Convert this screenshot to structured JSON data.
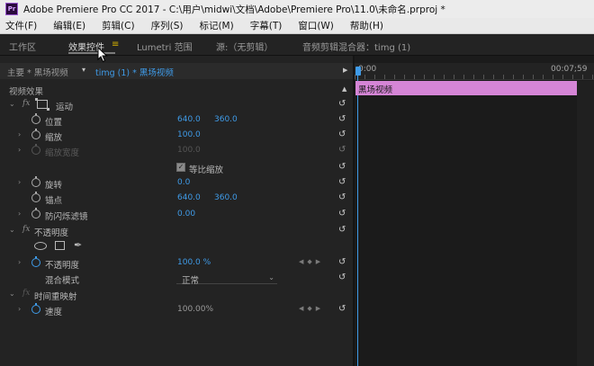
{
  "window": {
    "app_icon": "Pr",
    "title": "Adobe Premiere Pro CC 2017 - C:\\用户\\midwi\\文档\\Adobe\\Premiere Pro\\11.0\\未命名.prproj *"
  },
  "menu": [
    "文件(F)",
    "编辑(E)",
    "剪辑(C)",
    "序列(S)",
    "标记(M)",
    "字幕(T)",
    "窗口(W)",
    "帮助(H)"
  ],
  "tabs": [
    {
      "label": "工作区",
      "active": false
    },
    {
      "label": "效果控件",
      "active": true
    },
    {
      "label": "Lumetri 范围",
      "active": false
    },
    {
      "label": "源:（无剪辑）",
      "active": false
    },
    {
      "label": "音频剪辑混合器：timg (1)",
      "active": false
    }
  ],
  "tab_menu_icon": "≡",
  "effect_controls": {
    "master_label": "主要 * 黑场视频",
    "clip_label": "timg (1) * 黑场视频",
    "section_title": "视频效果",
    "motion": {
      "name": "运动",
      "position": {
        "label": "位置",
        "x": "640.0",
        "y": "360.0"
      },
      "scale": {
        "label": "缩放",
        "value": "100.0"
      },
      "scale_width": {
        "label": "缩放宽度",
        "value": "100.0"
      },
      "uniform_scale": {
        "label": "等比缩放",
        "checked": true
      },
      "rotation": {
        "label": "旋转",
        "value": "0.0"
      },
      "anchor": {
        "label": "锚点",
        "x": "640.0",
        "y": "360.0"
      },
      "anti_flicker": {
        "label": "防闪烁滤镜",
        "value": "0.00"
      }
    },
    "opacity": {
      "name": "不透明度",
      "opacity": {
        "label": "不透明度",
        "value": "100.0 %"
      },
      "blend_mode": {
        "label": "混合模式",
        "value": "正常"
      }
    },
    "time_remap": {
      "name": "时间重映射",
      "speed": {
        "label": "速度",
        "value": "100.00%"
      }
    }
  },
  "timeline": {
    "start_time": "0:00",
    "end_time": "00:07;59",
    "clip_name": "黑场视频",
    "clip_color": "#d585d6"
  },
  "colors": {
    "accent_blue": "#3f9be8",
    "tab_menu_yellow": "#d4b000"
  }
}
